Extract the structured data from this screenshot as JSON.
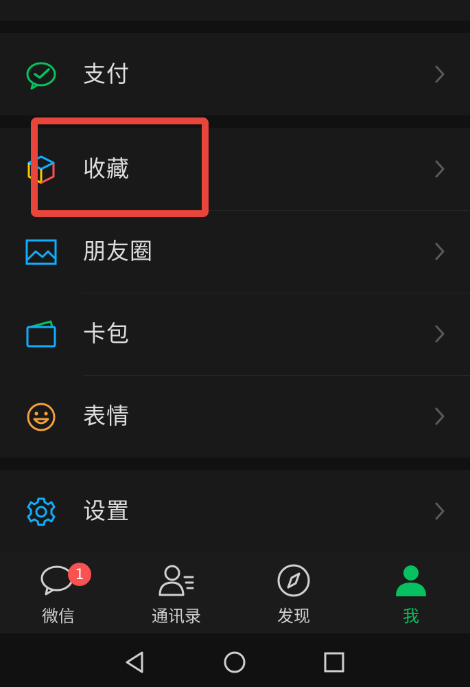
{
  "menu": {
    "items": [
      {
        "label": "支付",
        "icon": "wallet-check-icon",
        "color": "#07c160"
      },
      {
        "label": "收藏",
        "icon": "favorites-cube-icon",
        "color": "#ffc300"
      },
      {
        "label": "朋友圈",
        "icon": "moments-image-icon",
        "color": "#10aeff"
      },
      {
        "label": "卡包",
        "icon": "card-wallet-icon",
        "color": "#10aeff"
      },
      {
        "label": "表情",
        "icon": "smiley-icon",
        "color": "#f3a03c"
      },
      {
        "label": "设置",
        "icon": "gear-icon",
        "color": "#10aeff"
      }
    ]
  },
  "tabbar": {
    "tabs": [
      {
        "label": "微信",
        "icon": "chat-bubble-icon",
        "badge": "1",
        "active": false
      },
      {
        "label": "通讯录",
        "icon": "contacts-icon",
        "active": false
      },
      {
        "label": "发现",
        "icon": "compass-icon",
        "active": false
      },
      {
        "label": "我",
        "icon": "person-icon",
        "active": true
      }
    ],
    "active_color": "#07c160"
  },
  "highlight": {
    "color": "#e8453c",
    "target": "收藏"
  }
}
